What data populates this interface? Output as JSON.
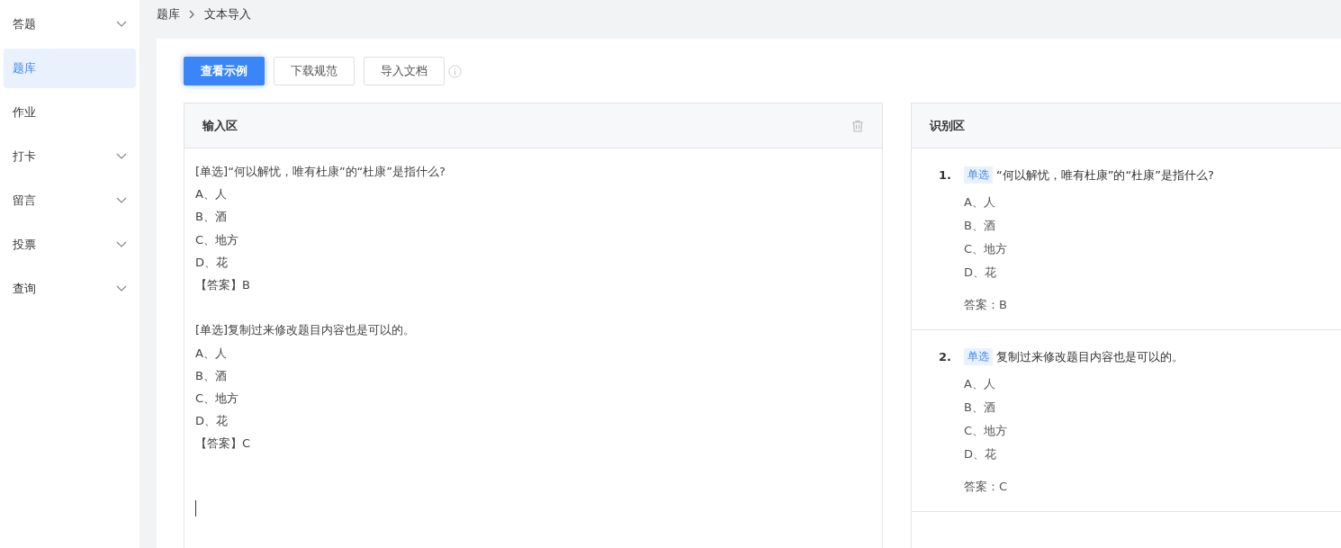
{
  "sidebar": {
    "items": [
      {
        "label": "答题",
        "expandable": true,
        "selected": false
      },
      {
        "label": "题库",
        "expandable": false,
        "selected": true
      },
      {
        "label": "作业",
        "expandable": false,
        "selected": false
      },
      {
        "label": "打卡",
        "expandable": true,
        "selected": false
      },
      {
        "label": "留言",
        "expandable": true,
        "selected": false
      },
      {
        "label": "投票",
        "expandable": true,
        "selected": false
      },
      {
        "label": "查询",
        "expandable": true,
        "selected": false
      }
    ]
  },
  "breadcrumb": [
    "题库",
    "文本导入"
  ],
  "toolbar": {
    "buttons": [
      {
        "label": "查看示例",
        "primary": true
      },
      {
        "label": "下载规范",
        "primary": false
      },
      {
        "label": "导入文档",
        "primary": false
      }
    ]
  },
  "input_panel": {
    "title": "输入区",
    "blocks": [
      [
        "[单选]“何以解忧，唯有杜康”的“杜康”是指什么?",
        "A、人",
        "B、酒",
        "C、地方",
        "D、花",
        "【答案】B"
      ],
      [
        "[单选]复制过来修改题目内容也是可以的。",
        "A、人",
        "B、酒",
        "C、地方",
        "D、花",
        "【答案】C"
      ]
    ]
  },
  "result_panel": {
    "title": "识别区",
    "questions": [
      {
        "number": "1.",
        "type": "单选",
        "stem": "“何以解忧，唯有杜康”的“杜康”是指什么?",
        "options": [
          "A、人",
          "B、酒",
          "C、地方",
          "D、花"
        ],
        "answer": "答案：B"
      },
      {
        "number": "2.",
        "type": "单选",
        "stem": "复制过来修改题目内容也是可以的。",
        "options": [
          "A、人",
          "B、酒",
          "C、地方",
          "D、花"
        ],
        "answer": "答案：C"
      }
    ]
  }
}
